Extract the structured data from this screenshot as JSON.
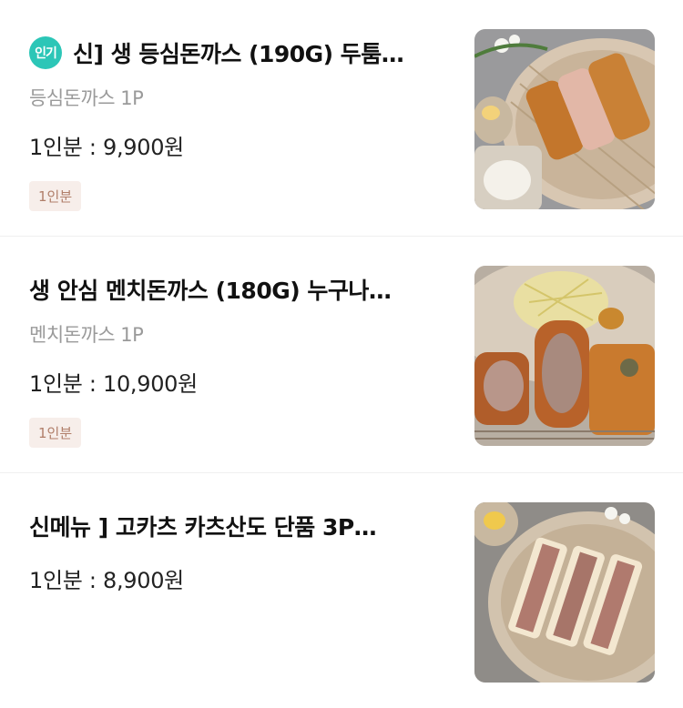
{
  "menu": {
    "items": [
      {
        "badge": "인기",
        "title": "신] 생 등심돈까스 (190G) 두툼…",
        "subtitle": "등심돈까스 1P",
        "price": "1인분 : 9,900원",
        "tag": "1인분",
        "image": "pork-loin-cutlet-photo"
      },
      {
        "title": "생 안심 멘치돈까스 (180G) 누구나…",
        "subtitle": "멘치돈까스 1P",
        "price": "1인분 : 10,900원",
        "tag": "1인분",
        "image": "menchi-katsu-photo"
      },
      {
        "title": "신메뉴 ] 고카츠 카츠산도 단품 3P…",
        "price": "1인분 : 8,900원",
        "image": "katsu-sando-photo"
      }
    ]
  },
  "colors": {
    "badge_bg": "#2cc6b7",
    "tag_bg": "#f7eeea",
    "tag_text": "#b07e69"
  }
}
